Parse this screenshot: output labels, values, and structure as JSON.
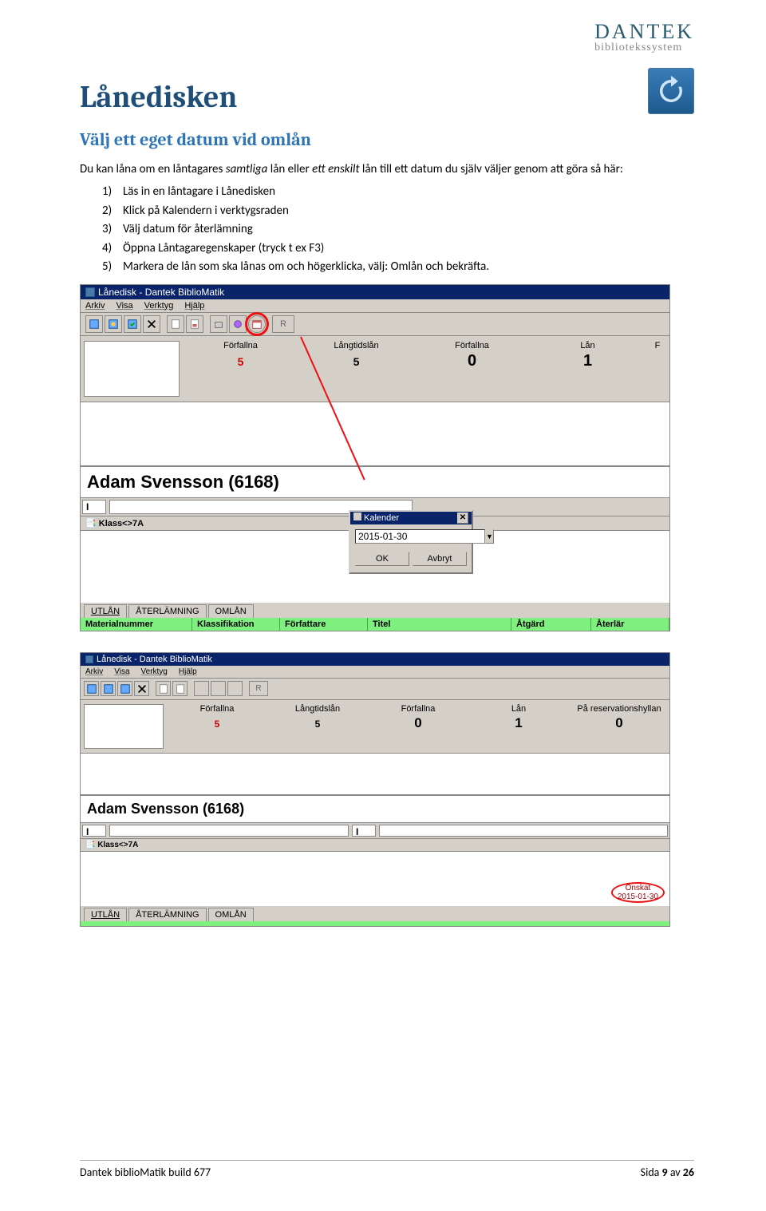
{
  "brand": {
    "name": "DANTEK",
    "sub": "bibliotekssystem"
  },
  "heading1": "Lånedisken",
  "heading2": "Välj ett eget datum vid omlån",
  "intro": {
    "before_em1": "Du kan låna om en låntagares ",
    "em1": "samtliga",
    "between": " lån eller ",
    "em2": "ett enskilt",
    "after_em2": " lån till ett datum du själv väljer genom att göra så här:"
  },
  "steps": [
    "Läs in en låntagare i Lånedisken",
    "Klick på Kalendern i verktygsraden",
    "Välj datum för återlämning",
    "Öppna Låntagaregenskaper (tryck t ex F3)",
    "Markera de lån som ska lånas om och högerklicka, välj: Omlån och bekräfta."
  ],
  "win1": {
    "title": "Lånedisk - Dantek BiblioMatik",
    "menus": [
      "Arkiv",
      "Visa",
      "Verktyg",
      "Hjälp"
    ],
    "stats": [
      {
        "label": "Förfallna",
        "value": "5",
        "style": "red"
      },
      {
        "label": "Långtidslån",
        "value": "5",
        "style": "small"
      },
      {
        "label": "Förfallna",
        "value": "0",
        "style": "big"
      },
      {
        "label": "Lån",
        "value": "1",
        "style": "big"
      },
      {
        "label": "F",
        "value": "",
        "style": "big"
      }
    ],
    "borrower": "Adam Svensson (6168)",
    "class": "Klass<>7A",
    "tabs": [
      "UTLÅN",
      "ÅTERLÄMNING",
      "OMLÅN"
    ],
    "table_headers": [
      "Materialnummer",
      "Klassifikation",
      "Författare",
      "Titel",
      "Åtgärd",
      "Återlär"
    ],
    "calendar": {
      "title": "Kalender",
      "value": "2015-01-30",
      "ok": "OK",
      "cancel": "Avbryt"
    }
  },
  "win2": {
    "title": "Lånedisk - Dantek BiblioMatik",
    "menus": [
      "Arkiv",
      "Visa",
      "Verktyg",
      "Hjälp"
    ],
    "stats": [
      {
        "label": "Förfallna",
        "value": "5",
        "style": "red"
      },
      {
        "label": "Långtidslån",
        "value": "5",
        "style": "small"
      },
      {
        "label": "Förfallna",
        "value": "0",
        "style": "big"
      },
      {
        "label": "Lån",
        "value": "1",
        "style": "big"
      },
      {
        "label": "På reservationshyllan",
        "value": "0",
        "style": "big"
      }
    ],
    "borrower": "Adam Svensson (6168)",
    "class": "Klass<>7A",
    "tabs": [
      "UTLÅN",
      "ÅTERLÄMNING",
      "OMLÅN"
    ],
    "onskat_label": "Önskat",
    "onskat_date": "2015-01-30"
  },
  "footer": {
    "left": "Dantek biblioMatik build 677",
    "right_prefix": "Sida ",
    "page": "9",
    "of_word": " av ",
    "total": "26"
  }
}
